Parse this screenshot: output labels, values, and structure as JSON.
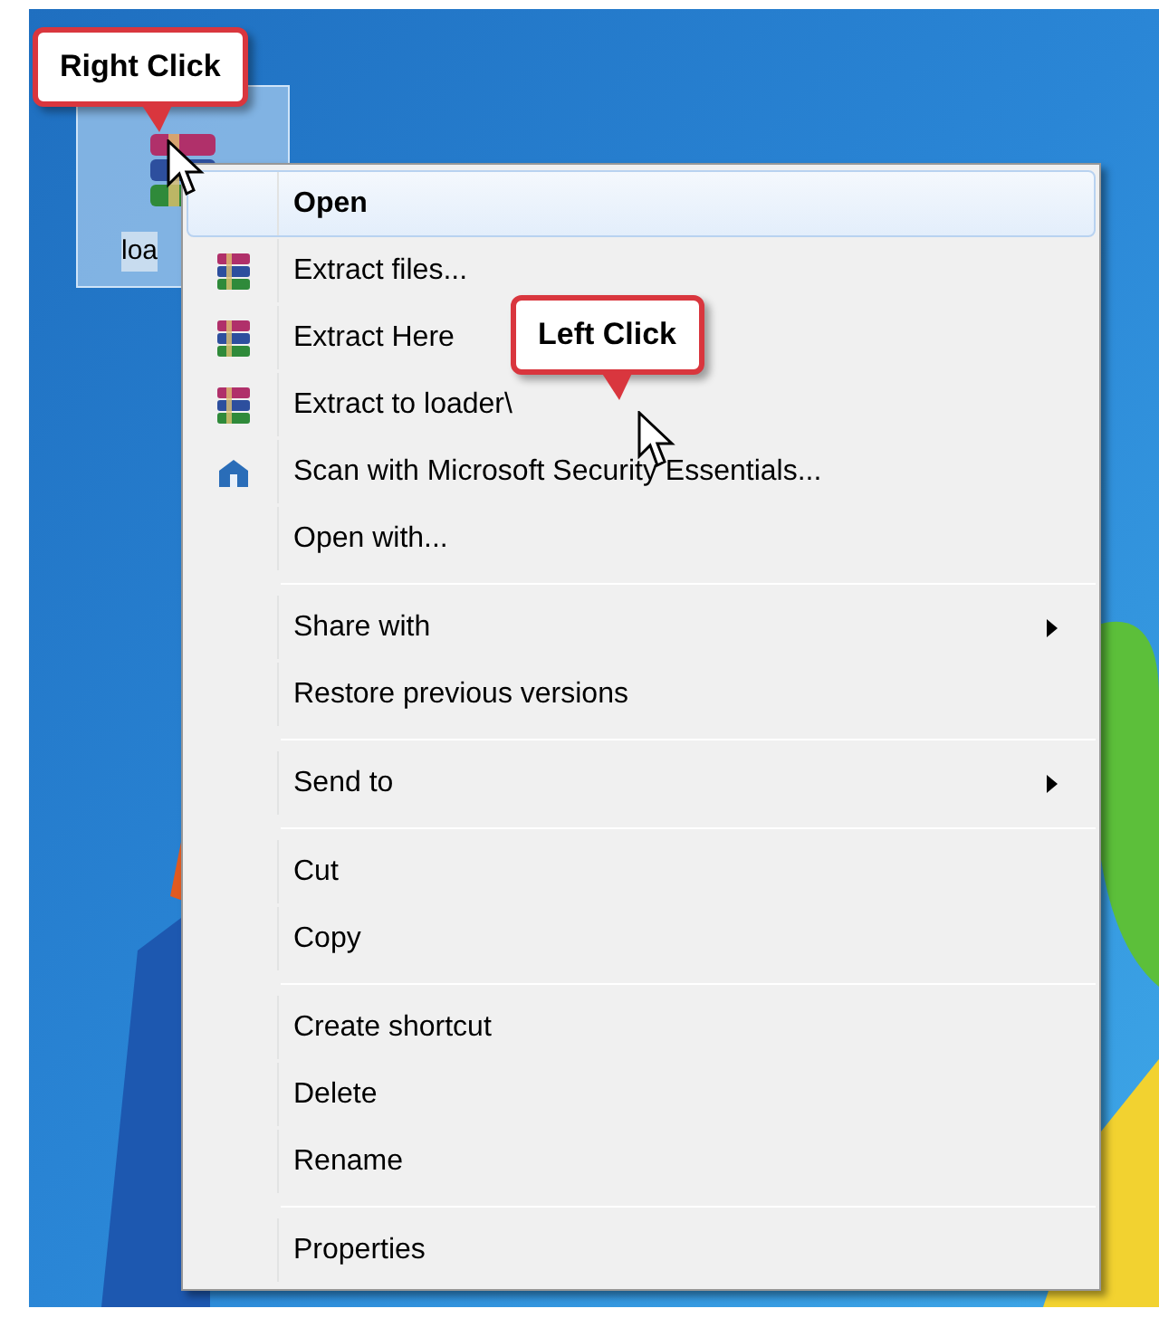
{
  "desktop_icon": {
    "label": "loa",
    "selected": true
  },
  "callouts": [
    {
      "text": "Right Click"
    },
    {
      "text": "Left Click"
    }
  ],
  "context_menu": {
    "groups": [
      [
        {
          "label": "Open",
          "kind": "plain",
          "selected": true,
          "submenu": false
        },
        {
          "label": "Extract files...",
          "kind": "archive",
          "selected": false,
          "submenu": false
        },
        {
          "label": "Extract Here",
          "kind": "archive",
          "selected": false,
          "submenu": false
        },
        {
          "label": "Extract to loader\\",
          "kind": "archive",
          "selected": false,
          "submenu": false
        },
        {
          "label": "Scan with Microsoft Security Essentials...",
          "kind": "scan",
          "selected": false,
          "submenu": false
        },
        {
          "label": "Open with...",
          "kind": "plain",
          "selected": false,
          "submenu": false
        }
      ],
      [
        {
          "label": "Share with",
          "kind": "plain",
          "selected": false,
          "submenu": true
        },
        {
          "label": "Restore previous versions",
          "kind": "plain",
          "selected": false,
          "submenu": false
        }
      ],
      [
        {
          "label": "Send to",
          "kind": "plain",
          "selected": false,
          "submenu": true
        }
      ],
      [
        {
          "label": "Cut",
          "kind": "plain",
          "selected": false,
          "submenu": false
        },
        {
          "label": "Copy",
          "kind": "plain",
          "selected": false,
          "submenu": false
        }
      ],
      [
        {
          "label": "Create shortcut",
          "kind": "plain",
          "selected": false,
          "submenu": false
        },
        {
          "label": "Delete",
          "kind": "plain",
          "selected": false,
          "submenu": false
        },
        {
          "label": "Rename",
          "kind": "plain",
          "selected": false,
          "submenu": false
        }
      ],
      [
        {
          "label": "Properties",
          "kind": "plain",
          "selected": false,
          "submenu": false
        }
      ]
    ]
  }
}
